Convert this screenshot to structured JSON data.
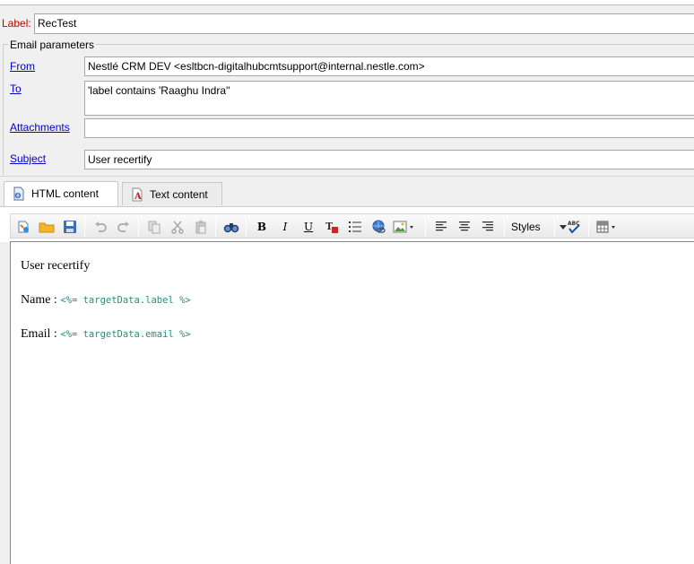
{
  "form": {
    "label_caption": "Label:",
    "label_value": "RecTest"
  },
  "email_params": {
    "legend": "Email parameters",
    "from_label": "From",
    "from_value": "Nestlé CRM DEV <esltbcn-digitalhubcmtsupport@internal.nestle.com>",
    "to_label": "To",
    "to_value": "'label contains 'Raaghu Indra''",
    "attachments_label": "Attachments",
    "attachments_value": "",
    "subject_label": "Subject",
    "subject_value": "User recertify"
  },
  "tabs": [
    {
      "label": "HTML content",
      "active": true,
      "icon": "html-document-icon"
    },
    {
      "label": "Text content",
      "active": false,
      "icon": "text-document-icon"
    }
  ],
  "toolbar": {
    "styles_label": "Styles",
    "icons": [
      "new-icon",
      "open-folder-icon",
      "save-icon",
      "undo-icon",
      "redo-icon",
      "copy-icon",
      "cut-icon",
      "paste-icon",
      "find-binoculars-icon",
      "bold-icon",
      "italic-icon",
      "underline-icon",
      "text-color-icon",
      "bullet-list-icon",
      "insert-link-icon",
      "insert-image-icon",
      "align-left-icon",
      "align-center-icon",
      "align-right-icon",
      "spellcheck-icon",
      "table-icon"
    ],
    "bold_glyph": "B",
    "italic_glyph": "I",
    "underline_glyph": "U"
  },
  "editor": {
    "line1": "User recertify",
    "name_label": "Name : ",
    "name_code": "<%= targetData.label %>",
    "email_label": "Email : ",
    "email_code": "<%= targetData.email %>"
  },
  "colors": {
    "label_red": "#c00000",
    "link_blue": "#0000cc",
    "code_teal": "#2e8b7a"
  }
}
